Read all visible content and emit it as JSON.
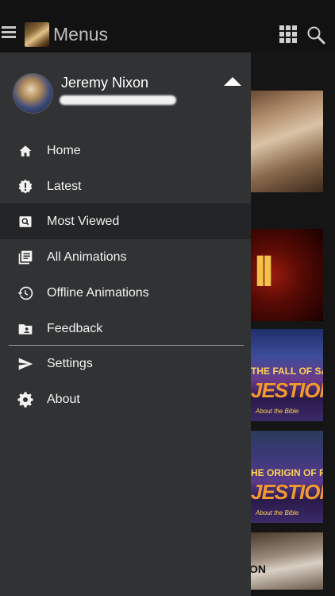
{
  "appbar": {
    "title": "Menus"
  },
  "user": {
    "name": "Jeremy Nixon"
  },
  "menu": {
    "items": [
      {
        "label": "Home",
        "icon": "home-icon"
      },
      {
        "label": "Latest",
        "icon": "alert-badge-icon"
      },
      {
        "label": "Most Viewed",
        "icon": "image-search-icon"
      },
      {
        "label": "All Animations",
        "icon": "library-icon"
      },
      {
        "label": "Offline Animations",
        "icon": "history-icon"
      },
      {
        "label": "Feedback",
        "icon": "contact-folder-icon"
      },
      {
        "label": "Settings",
        "icon": "send-icon"
      },
      {
        "label": "About",
        "icon": "gear-icon"
      }
    ],
    "active_index": 2
  },
  "background": {
    "thumb_text": [
      "II",
      "THE FALL OF SATAN",
      "JESTIONS",
      "About the Bible",
      "HE ORIGIN OF RACES",
      "JESTIONS",
      "About the Bible",
      "ON"
    ]
  },
  "colors": {
    "drawer": "#303233",
    "active_row": "#232526",
    "appbar": "#121212"
  }
}
